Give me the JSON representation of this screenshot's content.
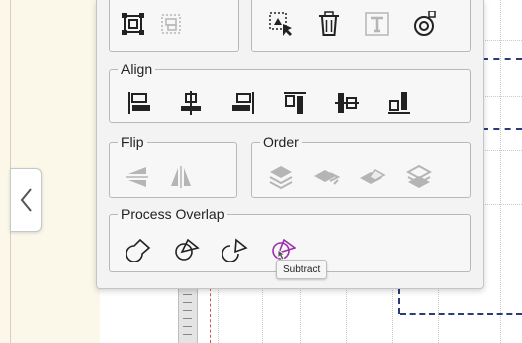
{
  "panel": {
    "align_group": {
      "label": "Align"
    },
    "flip_group": {
      "label": "Flip"
    },
    "order_group": {
      "label": "Order"
    },
    "overlap_group": {
      "label": "Process Overlap"
    }
  },
  "tooltip": {
    "text": "Subtract"
  },
  "colors": {
    "icon_active": "#222222",
    "icon_disabled": "#b5b5b5",
    "accent": "#9b2fae"
  },
  "icons": {
    "top_left": [
      "group-icon",
      "ungroup-icon"
    ],
    "top_right": [
      "select-mask-icon",
      "trash-icon",
      "text-tool-icon",
      "shape-edit-icon"
    ],
    "align": [
      "align-left-icon",
      "align-center-horizontal-icon",
      "align-right-icon",
      "align-top-icon",
      "align-middle-vertical-icon",
      "align-bottom-icon"
    ],
    "flip": [
      "flip-vertical-icon",
      "flip-horizontal-icon"
    ],
    "order": [
      "bring-to-front-icon",
      "bring-forward-icon",
      "send-backward-icon",
      "send-to-back-icon"
    ],
    "overlap": [
      "unite-icon",
      "intersect-icon",
      "exclude-icon",
      "subtract-icon"
    ]
  }
}
